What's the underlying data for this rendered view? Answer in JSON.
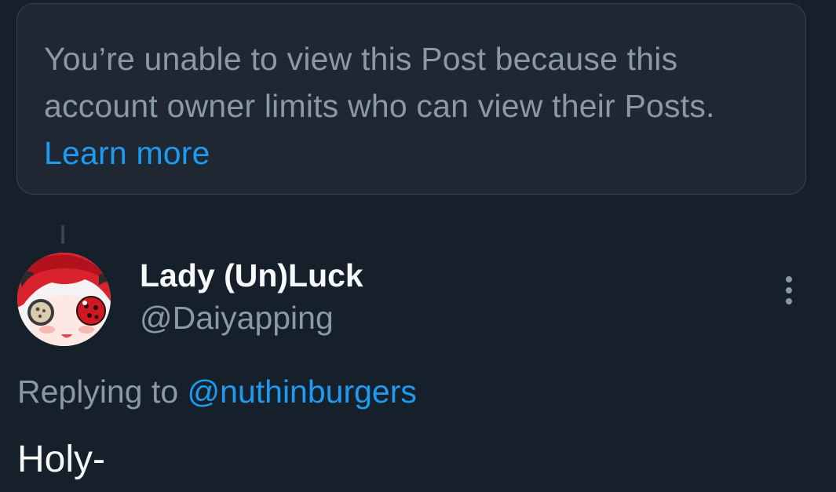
{
  "notice": {
    "text": "You’re unable to view this Post because this account owner limits who can view their Posts.",
    "link_label": "Learn more"
  },
  "post": {
    "author": {
      "display_name": "Lady (Un)Luck",
      "handle": "@Daiyapping"
    },
    "more_icon": "more-vertical-icon",
    "replying_prefix": "Replying to",
    "replying_to": "@nuthinburgers",
    "text": "Holy-"
  },
  "colors": {
    "background": "#15202b",
    "card_background": "#1e2732",
    "border": "#38444d",
    "primary_text": "#f7f9f9",
    "secondary_text": "#8b98a5",
    "link": "#1d9bf0"
  }
}
